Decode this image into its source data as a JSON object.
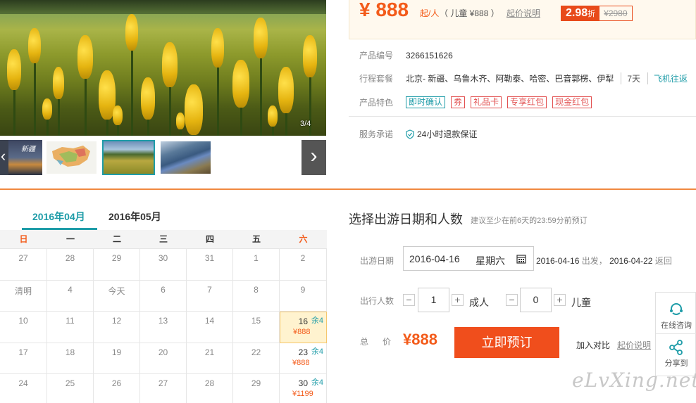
{
  "gallery": {
    "counter": "3/4",
    "thumbnails": [
      "map-thumbnail",
      "meadow-thumbnail",
      "river-thumbnail"
    ],
    "partial_thumb_text": "新疆"
  },
  "price": {
    "main": "¥ 888",
    "unit": "起/人",
    "child": "（ 儿童 ¥888 ）",
    "note": "起价说明",
    "discount": "2.98",
    "discount_suffix": "折",
    "original": "¥2980"
  },
  "info": {
    "code_label": "产品编号",
    "code": "3266151626",
    "route_label": "行程套餐",
    "route": "北京- 新疆、乌鲁木齐、阿勒泰、哈密、巴音郭楞、伊犁",
    "days": "7天",
    "flight": "飞机往返",
    "features_label": "产品特色",
    "tags": [
      "即时确认",
      "券",
      "礼品卡",
      "专享红包",
      "现金红包"
    ],
    "promise_label": "服务承诺",
    "promise": "24小时退款保证"
  },
  "calendar": {
    "tabs": [
      "2016年04月",
      "2016年05月"
    ],
    "weekdays": [
      "日",
      "一",
      "二",
      "三",
      "四",
      "五",
      "六"
    ],
    "rows": [
      [
        {
          "d": "27"
        },
        {
          "d": "28"
        },
        {
          "d": "29"
        },
        {
          "d": "30"
        },
        {
          "d": "31"
        },
        {
          "d": "1"
        },
        {
          "d": "2"
        }
      ],
      [
        {
          "d": "清明"
        },
        {
          "d": "4"
        },
        {
          "d": "今天"
        },
        {
          "d": "6"
        },
        {
          "d": "7"
        },
        {
          "d": "8"
        },
        {
          "d": "9"
        }
      ],
      [
        {
          "d": "10"
        },
        {
          "d": "11"
        },
        {
          "d": "12"
        },
        {
          "d": "13"
        },
        {
          "d": "14"
        },
        {
          "d": "15"
        },
        {
          "d": "16",
          "rem": "余4",
          "price": "¥888",
          "hl": true
        }
      ],
      [
        {
          "d": "17"
        },
        {
          "d": "18"
        },
        {
          "d": "19"
        },
        {
          "d": "20"
        },
        {
          "d": "21"
        },
        {
          "d": "22"
        },
        {
          "d": "23",
          "rem": "余4",
          "price": "¥888"
        }
      ],
      [
        {
          "d": "24"
        },
        {
          "d": "25"
        },
        {
          "d": "26"
        },
        {
          "d": "27"
        },
        {
          "d": "28"
        },
        {
          "d": "29"
        },
        {
          "d": "30",
          "rem": "余4",
          "price": "¥1199"
        }
      ]
    ]
  },
  "booking": {
    "title": "选择出游日期和人数",
    "subtitle": "建议至少在前6天的23:59分前预订",
    "date_label": "出游日期",
    "date_value": "2016-04-16",
    "weekday": "星期六",
    "depart": "2016-04-16",
    "depart_text": "出发，",
    "return": "2016-04-22",
    "return_text": "返回",
    "people_label": "出行人数",
    "adults": "1",
    "adults_label": "成人",
    "children": "0",
    "children_label": "儿童",
    "minus": "−",
    "plus": "+",
    "total_label": "总价",
    "total": "¥888",
    "book_label": "立即预订",
    "compare": "加入对比",
    "price_info": "起价说明"
  },
  "side": {
    "consult": "在线咨询",
    "share": "分享到"
  },
  "watermark": "eLvXing.net",
  "colors": {
    "accent": "#f35b1a",
    "teal": "#1e9ca8",
    "button": "#f04e1c"
  }
}
